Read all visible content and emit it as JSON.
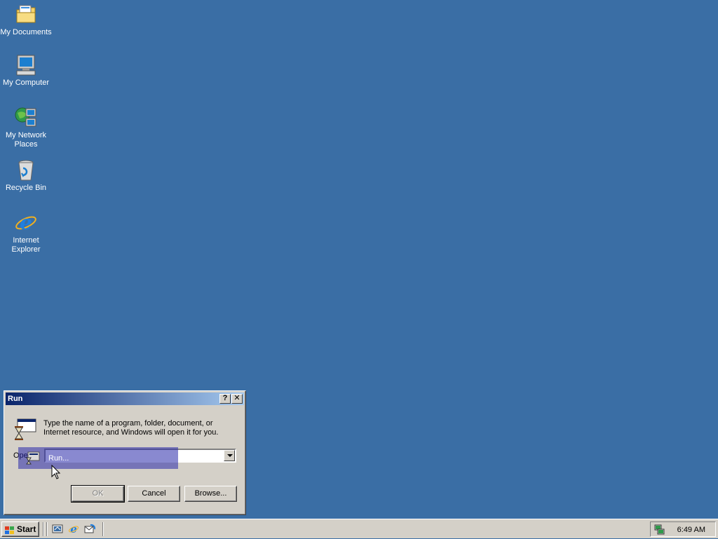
{
  "desktop": {
    "icons": [
      {
        "label": "My Documents",
        "icon": "folder-documents-icon"
      },
      {
        "label": "My Computer",
        "icon": "computer-icon"
      },
      {
        "label": "My Network Places",
        "icon": "network-places-icon"
      },
      {
        "label": "Recycle Bin",
        "icon": "recycle-bin-icon"
      },
      {
        "label": "Internet Explorer",
        "icon": "internet-explorer-icon"
      }
    ]
  },
  "dialog": {
    "title": "Run",
    "help_label": "?",
    "close_label": "✕",
    "description": "Type the name of a program, folder, document, or Internet resource, and Windows will open it for you.",
    "open_label": "Open:",
    "open_value": "",
    "drag_label": "Run...",
    "ok_label": "OK",
    "cancel_label": "Cancel",
    "browse_label": "Browse..."
  },
  "taskbar": {
    "start_label": "Start",
    "quick_launch": [
      "show-desktop-icon",
      "internet-explorer-icon",
      "outlook-express-icon"
    ],
    "clock": "6:49 AM"
  },
  "colors": {
    "desktop": "#3a6ea5",
    "title_start": "#0a246a",
    "title_end": "#a6caf0",
    "face": "#d4d0c8"
  }
}
